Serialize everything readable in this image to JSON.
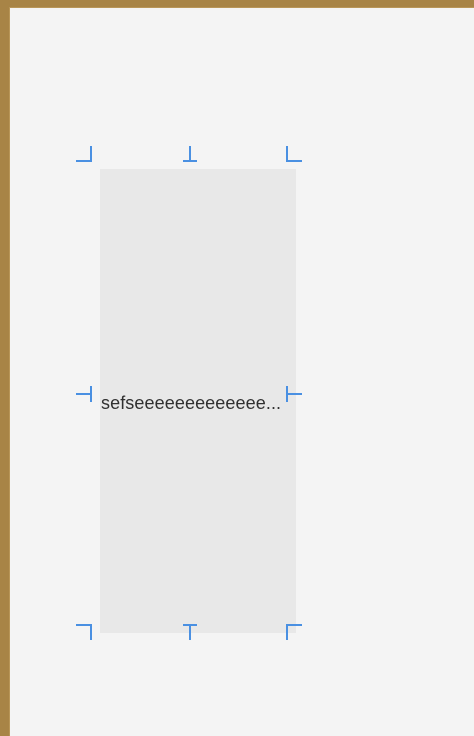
{
  "canvas": {
    "background": "#f4f4f4",
    "frame_color": "#a88446"
  },
  "selected_label": {
    "text": "sefseeeeeeeeeeeee...",
    "fill": "#e8e8e8"
  },
  "handles": {
    "color": "#4a90e2",
    "items": [
      "top-left-handle",
      "top-center-handle",
      "top-right-handle",
      "middle-left-handle",
      "middle-right-handle",
      "bottom-left-handle",
      "bottom-center-handle",
      "bottom-right-handle"
    ]
  }
}
